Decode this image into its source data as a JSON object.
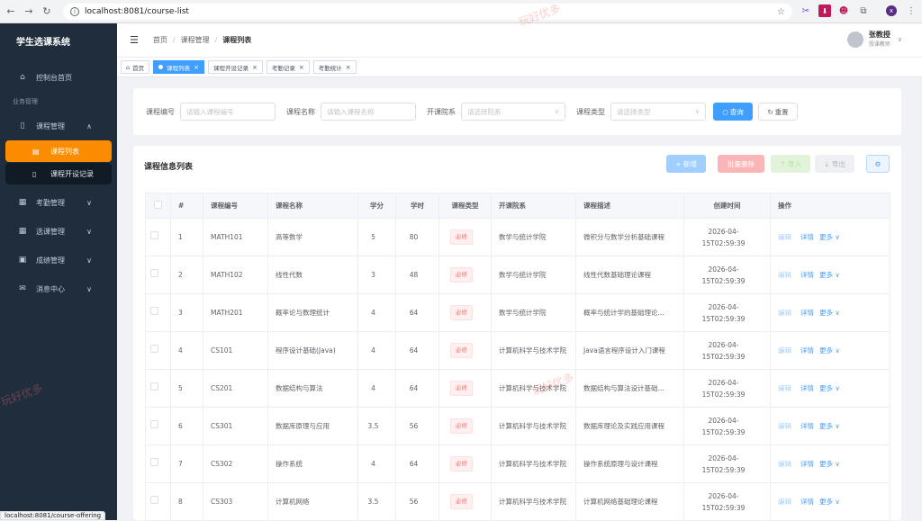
{
  "browser": {
    "url": "localhost:8081/course-list",
    "status_url": "localhost:8081/course-offering"
  },
  "sidebar": {
    "app_title": "学生选课系统",
    "dashboard": "控制台首页",
    "group_label": "业务管理",
    "course_mgmt": "课程管理",
    "course_list": "课程列表",
    "course_offering": "课程开设记录",
    "attendance": "考勤管理",
    "selection": "选课管理",
    "grades": "成绩管理",
    "messages": "消息中心"
  },
  "header": {
    "breadcrumb": [
      "首页",
      "课程管理",
      "课程列表"
    ],
    "user_name": "张教授",
    "user_role": "授课教师"
  },
  "tabs": [
    {
      "label": "首页",
      "active": false,
      "closable": false
    },
    {
      "label": "课程列表",
      "active": true,
      "closable": true
    },
    {
      "label": "课程开设记录",
      "active": false,
      "closable": true
    },
    {
      "label": "考勤记录",
      "active": false,
      "closable": true
    },
    {
      "label": "考勤统计",
      "active": false,
      "closable": true
    }
  ],
  "filter": {
    "code_label": "课程编号",
    "code_placeholder": "请输入课程编号",
    "name_label": "课程名称",
    "name_placeholder": "请输入课程名称",
    "dept_label": "开课院系",
    "dept_placeholder": "请选择院系",
    "type_label": "课程类型",
    "type_placeholder": "请选择类型",
    "search": "查询",
    "reset": "重置"
  },
  "list": {
    "title": "课程信息列表",
    "add": "+ 新增",
    "batch_delete": "批量删除",
    "import": "⇡ 导入",
    "export": "⇣ 导出"
  },
  "table": {
    "headers": [
      "#",
      "课程编号",
      "课程名称",
      "学分",
      "学时",
      "课程类型",
      "开课院系",
      "课程描述",
      "创建时间",
      "操作"
    ],
    "op_edit": "编辑",
    "op_detail": "详情",
    "op_more": "更多",
    "rows": [
      {
        "no": "1",
        "code": "MATH101",
        "name": "高等数学",
        "credit": "5",
        "hours": "80",
        "type": "必修",
        "dept": "数学与统计学院",
        "desc": "微积分与数学分析基础课程",
        "date": "2026-04-",
        "time": "15T02:59:39"
      },
      {
        "no": "2",
        "code": "MATH102",
        "name": "线性代数",
        "credit": "3",
        "hours": "48",
        "type": "必修",
        "dept": "数学与统计学院",
        "desc": "线性代数基础理论课程",
        "date": "2026-04-",
        "time": "15T02:59:39"
      },
      {
        "no": "3",
        "code": "MATH201",
        "name": "概率论与数理统计",
        "credit": "4",
        "hours": "64",
        "type": "必修",
        "dept": "数学与统计学院",
        "desc": "概率与统计学的基础理论...",
        "date": "2026-04-",
        "time": "15T02:59:39"
      },
      {
        "no": "4",
        "code": "CS101",
        "name": "程序设计基础(Java)",
        "credit": "4",
        "hours": "64",
        "type": "必修",
        "dept": "计算机科学与技术学院",
        "desc": "Java语言程序设计入门课程",
        "date": "2026-04-",
        "time": "15T02:59:39"
      },
      {
        "no": "5",
        "code": "CS201",
        "name": "数据结构与算法",
        "credit": "4",
        "hours": "64",
        "type": "必修",
        "dept": "计算机科学与技术学院",
        "desc": "数据结构与算法设计基础...",
        "date": "2026-04-",
        "time": "15T02:59:39"
      },
      {
        "no": "6",
        "code": "CS301",
        "name": "数据库原理与应用",
        "credit": "3.5",
        "hours": "56",
        "type": "必修",
        "dept": "计算机科学与技术学院",
        "desc": "数据库理论及实践应用课程",
        "date": "2026-04-",
        "time": "15T02:59:39"
      },
      {
        "no": "7",
        "code": "CS302",
        "name": "操作系统",
        "credit": "4",
        "hours": "64",
        "type": "必修",
        "dept": "计算机科学与技术学院",
        "desc": "操作系统原理与设计课程",
        "date": "2026-04-",
        "time": "15T02:59:39"
      },
      {
        "no": "8",
        "code": "CS303",
        "name": "计算机网络",
        "credit": "3.5",
        "hours": "56",
        "type": "必修",
        "dept": "计算机科学与技术学院",
        "desc": "计算机网络基础理论课程",
        "date": "2026-04-",
        "time": "15T02:59:39"
      }
    ]
  },
  "watermark": "玩好优多",
  "colors": {
    "sidebar": "#1f2d3d",
    "active_menu": "#fb8c00",
    "primary": "#409eff",
    "danger": "#f56c6c"
  }
}
